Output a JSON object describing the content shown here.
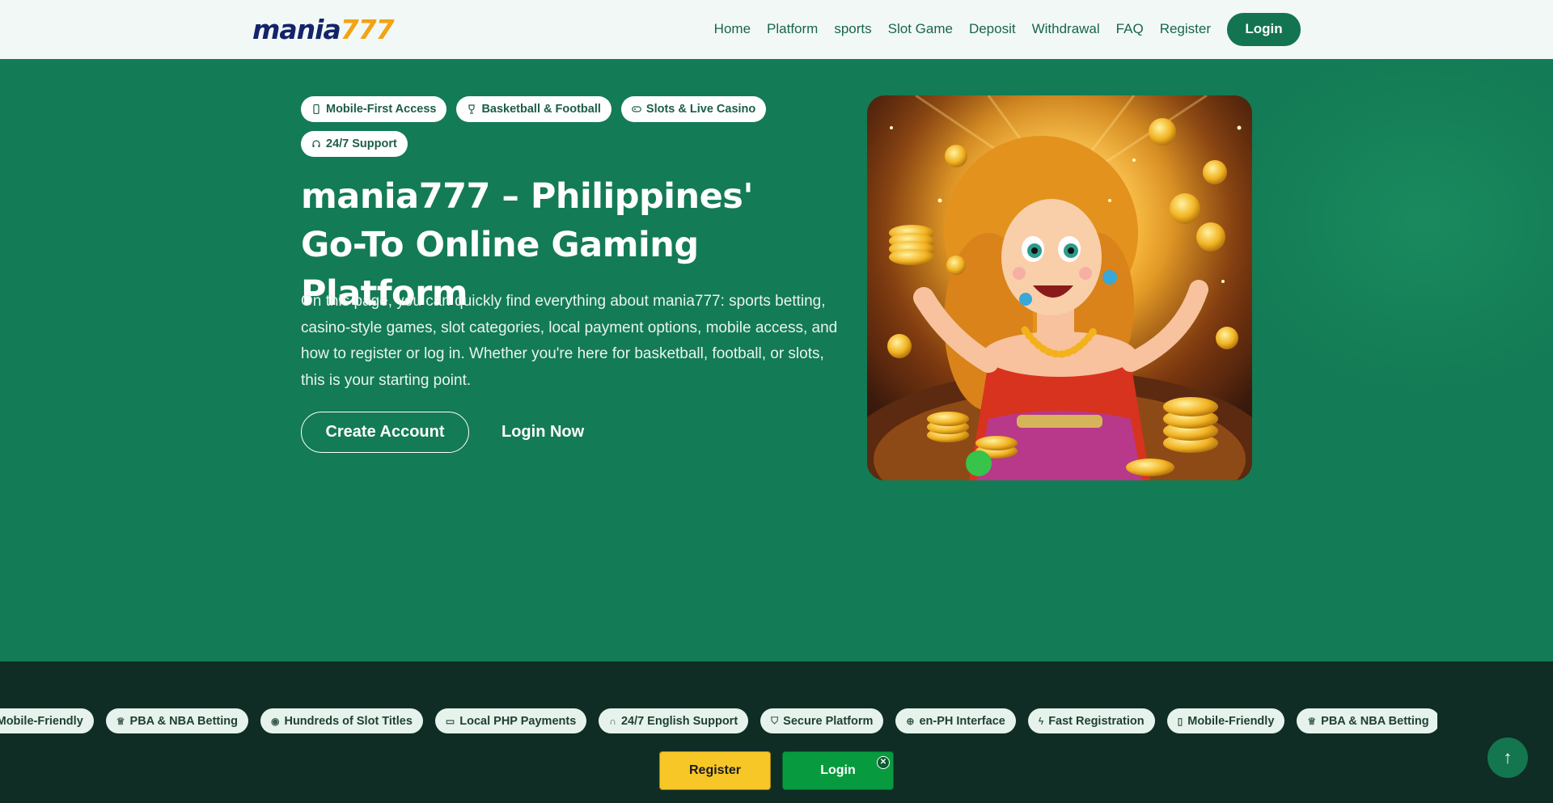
{
  "header": {
    "logo_part1": "mania",
    "logo_part2": "777",
    "nav": [
      "Home",
      "Platform",
      "sports",
      "Slot Game",
      "Deposit",
      "Withdrawal",
      "FAQ",
      "Register"
    ],
    "login_label": "Login"
  },
  "hero": {
    "chips": [
      {
        "label": "Mobile-First Access",
        "icon": "phone-icon"
      },
      {
        "label": "Basketball & Football",
        "icon": "trophy-icon"
      },
      {
        "label": "Slots & Live Casino",
        "icon": "gamepad-icon"
      },
      {
        "label": "24/7 Support",
        "icon": "headset-icon"
      }
    ],
    "title": "mania777 – Philippines' Go-To Online Gaming Platform",
    "description": "On this page, you can quickly find everything about mania777: sports betting, casino-style games, slot categories, local payment options, mobile access, and how to register or log in. Whether you're here for basketball, football, or slots, this is your starting point.",
    "create_account": "Create Account",
    "login_now": "Login Now"
  },
  "ticker": {
    "items": [
      {
        "label": "Mobile-Friendly",
        "icon": "phone-icon"
      },
      {
        "label": "PBA & NBA Betting",
        "icon": "trophy-icon"
      },
      {
        "label": "Hundreds of Slot Titles",
        "icon": "gamepad-icon"
      },
      {
        "label": "Local PHP Payments",
        "icon": "card-icon"
      },
      {
        "label": "24/7 English Support",
        "icon": "headset-icon"
      },
      {
        "label": "Secure Platform",
        "icon": "shield-icon"
      },
      {
        "label": "en-PH Interface",
        "icon": "globe-icon"
      },
      {
        "label": "Fast Registration",
        "icon": "bolt-icon"
      },
      {
        "label": "Mobile-Friendly",
        "icon": "phone-icon"
      },
      {
        "label": "PBA & NBA Betting",
        "icon": "trophy-icon"
      }
    ]
  },
  "sticky": {
    "register": "Register",
    "login": "Login",
    "close": "✕"
  },
  "scroll_top": "↑"
}
